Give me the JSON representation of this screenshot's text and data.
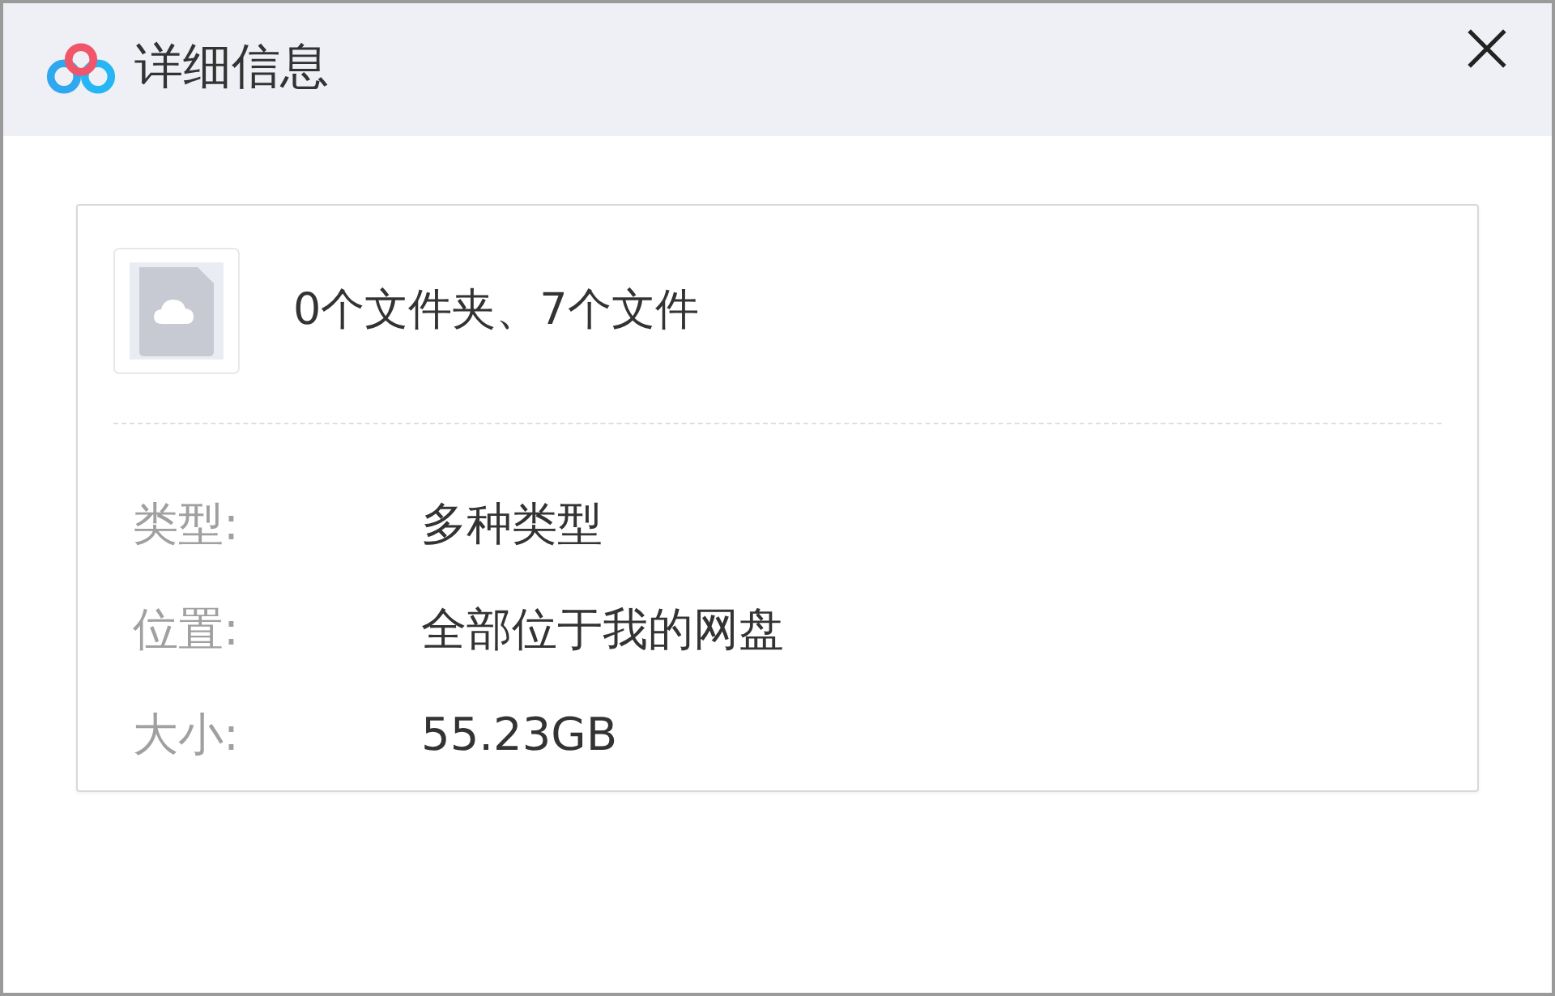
{
  "window": {
    "title": "详细信息"
  },
  "summary": "0个文件夹、7个文件",
  "details": [
    {
      "label": "类型:",
      "value": "多种类型"
    },
    {
      "label": "位置:",
      "value": "全部位于我的网盘"
    },
    {
      "label": "大小:",
      "value": "55.23GB"
    }
  ]
}
